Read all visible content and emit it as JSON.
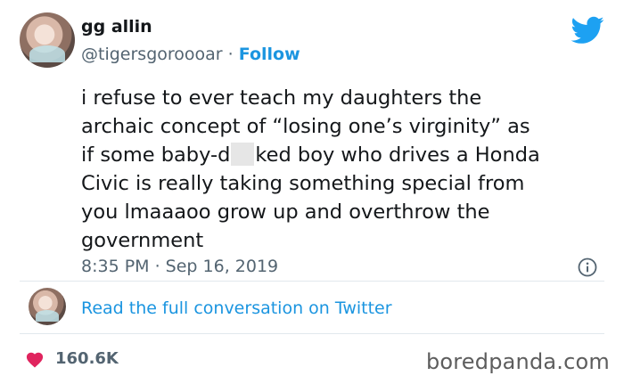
{
  "author": {
    "name": "gg allin",
    "handle": "@tigersgoroooar",
    "separator": "·",
    "follow_label": "Follow"
  },
  "tweet": {
    "lines": [
      "i refuse to ever teach my daughters the",
      "archaic concept of “losing one’s virginity” as",
      "if some baby-d",
      "ked boy who drives a Honda",
      "Civic is really taking something special from",
      "you lmaaaoo grow up and overthrow the",
      "government"
    ],
    "timestamp": "8:35 PM · Sep 16, 2019"
  },
  "conversation_link": "Read the full conversation on Twitter",
  "likes": "160.6K",
  "watermark": "boredpanda.com",
  "colors": {
    "accent": "#1b95e0",
    "like": "#e0245e",
    "muted": "#536471",
    "text": "#14171a"
  },
  "icons": {
    "logo": "twitter-bird-icon",
    "info": "info-icon",
    "like": "heart-icon"
  }
}
